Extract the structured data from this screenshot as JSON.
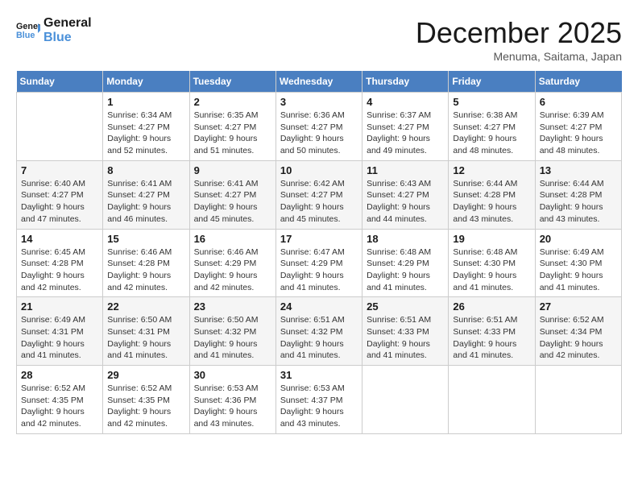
{
  "header": {
    "logo_line1": "General",
    "logo_line2": "Blue",
    "month": "December 2025",
    "location": "Menuma, Saitama, Japan"
  },
  "days_of_week": [
    "Sunday",
    "Monday",
    "Tuesday",
    "Wednesday",
    "Thursday",
    "Friday",
    "Saturday"
  ],
  "weeks": [
    [
      {
        "day": "",
        "info": ""
      },
      {
        "day": "1",
        "info": "Sunrise: 6:34 AM\nSunset: 4:27 PM\nDaylight: 9 hours\nand 52 minutes."
      },
      {
        "day": "2",
        "info": "Sunrise: 6:35 AM\nSunset: 4:27 PM\nDaylight: 9 hours\nand 51 minutes."
      },
      {
        "day": "3",
        "info": "Sunrise: 6:36 AM\nSunset: 4:27 PM\nDaylight: 9 hours\nand 50 minutes."
      },
      {
        "day": "4",
        "info": "Sunrise: 6:37 AM\nSunset: 4:27 PM\nDaylight: 9 hours\nand 49 minutes."
      },
      {
        "day": "5",
        "info": "Sunrise: 6:38 AM\nSunset: 4:27 PM\nDaylight: 9 hours\nand 48 minutes."
      },
      {
        "day": "6",
        "info": "Sunrise: 6:39 AM\nSunset: 4:27 PM\nDaylight: 9 hours\nand 48 minutes."
      }
    ],
    [
      {
        "day": "7",
        "info": "Sunrise: 6:40 AM\nSunset: 4:27 PM\nDaylight: 9 hours\nand 47 minutes."
      },
      {
        "day": "8",
        "info": "Sunrise: 6:41 AM\nSunset: 4:27 PM\nDaylight: 9 hours\nand 46 minutes."
      },
      {
        "day": "9",
        "info": "Sunrise: 6:41 AM\nSunset: 4:27 PM\nDaylight: 9 hours\nand 45 minutes."
      },
      {
        "day": "10",
        "info": "Sunrise: 6:42 AM\nSunset: 4:27 PM\nDaylight: 9 hours\nand 45 minutes."
      },
      {
        "day": "11",
        "info": "Sunrise: 6:43 AM\nSunset: 4:27 PM\nDaylight: 9 hours\nand 44 minutes."
      },
      {
        "day": "12",
        "info": "Sunrise: 6:44 AM\nSunset: 4:28 PM\nDaylight: 9 hours\nand 43 minutes."
      },
      {
        "day": "13",
        "info": "Sunrise: 6:44 AM\nSunset: 4:28 PM\nDaylight: 9 hours\nand 43 minutes."
      }
    ],
    [
      {
        "day": "14",
        "info": "Sunrise: 6:45 AM\nSunset: 4:28 PM\nDaylight: 9 hours\nand 42 minutes."
      },
      {
        "day": "15",
        "info": "Sunrise: 6:46 AM\nSunset: 4:28 PM\nDaylight: 9 hours\nand 42 minutes."
      },
      {
        "day": "16",
        "info": "Sunrise: 6:46 AM\nSunset: 4:29 PM\nDaylight: 9 hours\nand 42 minutes."
      },
      {
        "day": "17",
        "info": "Sunrise: 6:47 AM\nSunset: 4:29 PM\nDaylight: 9 hours\nand 41 minutes."
      },
      {
        "day": "18",
        "info": "Sunrise: 6:48 AM\nSunset: 4:29 PM\nDaylight: 9 hours\nand 41 minutes."
      },
      {
        "day": "19",
        "info": "Sunrise: 6:48 AM\nSunset: 4:30 PM\nDaylight: 9 hours\nand 41 minutes."
      },
      {
        "day": "20",
        "info": "Sunrise: 6:49 AM\nSunset: 4:30 PM\nDaylight: 9 hours\nand 41 minutes."
      }
    ],
    [
      {
        "day": "21",
        "info": "Sunrise: 6:49 AM\nSunset: 4:31 PM\nDaylight: 9 hours\nand 41 minutes."
      },
      {
        "day": "22",
        "info": "Sunrise: 6:50 AM\nSunset: 4:31 PM\nDaylight: 9 hours\nand 41 minutes."
      },
      {
        "day": "23",
        "info": "Sunrise: 6:50 AM\nSunset: 4:32 PM\nDaylight: 9 hours\nand 41 minutes."
      },
      {
        "day": "24",
        "info": "Sunrise: 6:51 AM\nSunset: 4:32 PM\nDaylight: 9 hours\nand 41 minutes."
      },
      {
        "day": "25",
        "info": "Sunrise: 6:51 AM\nSunset: 4:33 PM\nDaylight: 9 hours\nand 41 minutes."
      },
      {
        "day": "26",
        "info": "Sunrise: 6:51 AM\nSunset: 4:33 PM\nDaylight: 9 hours\nand 41 minutes."
      },
      {
        "day": "27",
        "info": "Sunrise: 6:52 AM\nSunset: 4:34 PM\nDaylight: 9 hours\nand 42 minutes."
      }
    ],
    [
      {
        "day": "28",
        "info": "Sunrise: 6:52 AM\nSunset: 4:35 PM\nDaylight: 9 hours\nand 42 minutes."
      },
      {
        "day": "29",
        "info": "Sunrise: 6:52 AM\nSunset: 4:35 PM\nDaylight: 9 hours\nand 42 minutes."
      },
      {
        "day": "30",
        "info": "Sunrise: 6:53 AM\nSunset: 4:36 PM\nDaylight: 9 hours\nand 43 minutes."
      },
      {
        "day": "31",
        "info": "Sunrise: 6:53 AM\nSunset: 4:37 PM\nDaylight: 9 hours\nand 43 minutes."
      },
      {
        "day": "",
        "info": ""
      },
      {
        "day": "",
        "info": ""
      },
      {
        "day": "",
        "info": ""
      }
    ]
  ]
}
